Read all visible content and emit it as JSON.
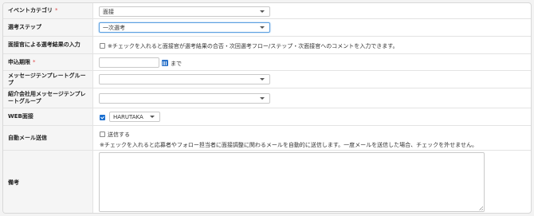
{
  "form": {
    "rows": [
      {
        "label": "イベントカテゴリ",
        "required": "*",
        "select_value": "面接"
      },
      {
        "label": "選考ステップ",
        "select_value": "一次選考"
      },
      {
        "label": "面接官による選考結果の入力",
        "checkbox_text": "※チェックを入れると面接官が選考結果の合否・次回選考フロー/ステップ・次面接官へのコメントを入力できます。"
      },
      {
        "label": "申込期限",
        "required": "*",
        "suffix": "まで",
        "date_value": ""
      },
      {
        "label": "メッセージテンプレートグループ",
        "select_value": ""
      },
      {
        "label": "紹介会社用メッセージテンプレートグループ",
        "select_value": ""
      },
      {
        "label": "WEB面接",
        "checked": true,
        "select_value": "HARUTAKA"
      },
      {
        "label": "自動メール送信",
        "checkbox_text": "送信する",
        "note": "※チェックを入れると応募者やフォロー担当者に面接調整に関わるメールを自動的に送信します。一度メールを送信した場合、チェックを外せません。"
      },
      {
        "label": "備考",
        "textarea_value": ""
      }
    ]
  },
  "icons": {
    "calendar": "calendar-icon",
    "dropdown": "chevron-down-icon"
  },
  "colors": {
    "accent": "#1a6fd0",
    "required": "#e04848"
  }
}
